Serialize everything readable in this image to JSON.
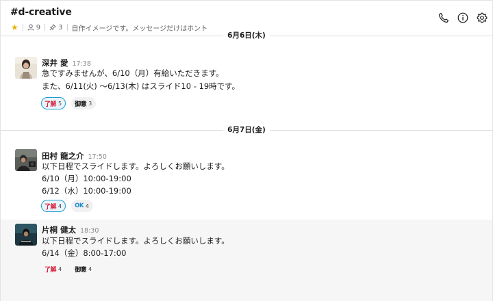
{
  "header": {
    "channel_name": "#d-creative",
    "members_count": "9",
    "pins_count": "3",
    "topic": "自作イメージです。メッセージだけはホント"
  },
  "icons": [
    "star-icon",
    "member-icon",
    "pin-icon",
    "phone-icon",
    "info-icon",
    "gear-icon"
  ],
  "colors": {
    "star": "#e8b300",
    "reaction_border": "#1d9bd1",
    "reaction_bg": "#eaf5fb",
    "ryokai_red": "#d81c3b"
  },
  "dates": {
    "d1": "6月6日(木)",
    "d2": "6月7日(金)"
  },
  "messages": [
    {
      "name": "深井 愛",
      "time": "17:38",
      "lines": [
        "急ですみませんが、6/10（月）有給いただきます。",
        "また、6/11(火) 〜6/13(木) はスライド10 - 19時です。"
      ],
      "reactions": [
        {
          "emoji": "了解",
          "count": "5"
        },
        {
          "emoji": "御意",
          "count": "3"
        }
      ]
    },
    {
      "name": "田村 龍之介",
      "time": "17:50",
      "lines": [
        "以下日程でスライドします。よろしくお願いします。",
        "6/10（月）10:00-19:00",
        "6/12（水）10:00-19:00"
      ],
      "reactions": [
        {
          "emoji": "了解",
          "count": "4"
        },
        {
          "emoji": "OK",
          "count": "4"
        }
      ]
    },
    {
      "name": "片桐 健太",
      "time": "18:30",
      "lines": [
        "以下日程でスライドします。よろしくお願いします。",
        "6/14（金）8:00-17:00"
      ],
      "reactions": [
        {
          "emoji": "了解",
          "count": "4"
        },
        {
          "emoji": "御意",
          "count": "4"
        }
      ]
    }
  ]
}
